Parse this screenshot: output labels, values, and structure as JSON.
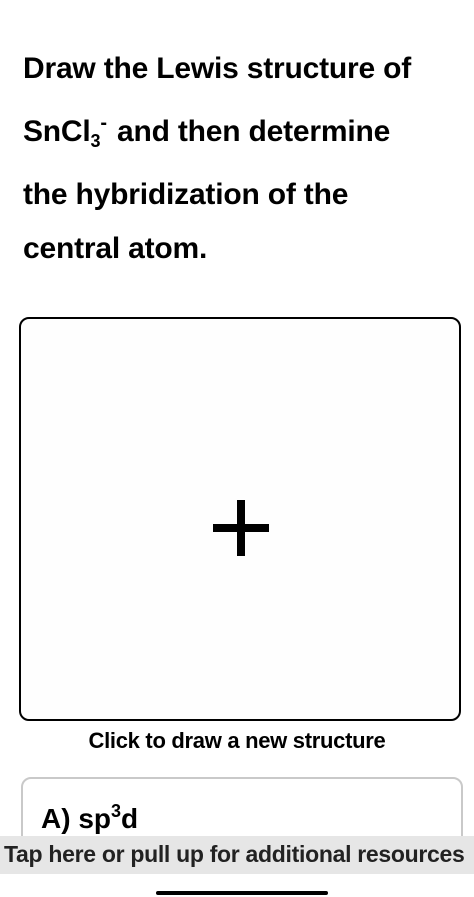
{
  "question": {
    "line1": "Draw the Lewis structure of",
    "formula_main": "SnCl",
    "formula_sub": "3",
    "formula_sup": "-",
    "line2_rest": " and then determine",
    "line3": "the hybridization of the",
    "line4": "central atom."
  },
  "drawing_area": {
    "icon": "plus-icon",
    "caption": "Click to draw a new structure"
  },
  "answer_option": {
    "prefix": "A) sp",
    "sup": "3",
    "suffix": "d"
  },
  "resource_bar": {
    "text": "Tap here or pull up for additional resources"
  }
}
